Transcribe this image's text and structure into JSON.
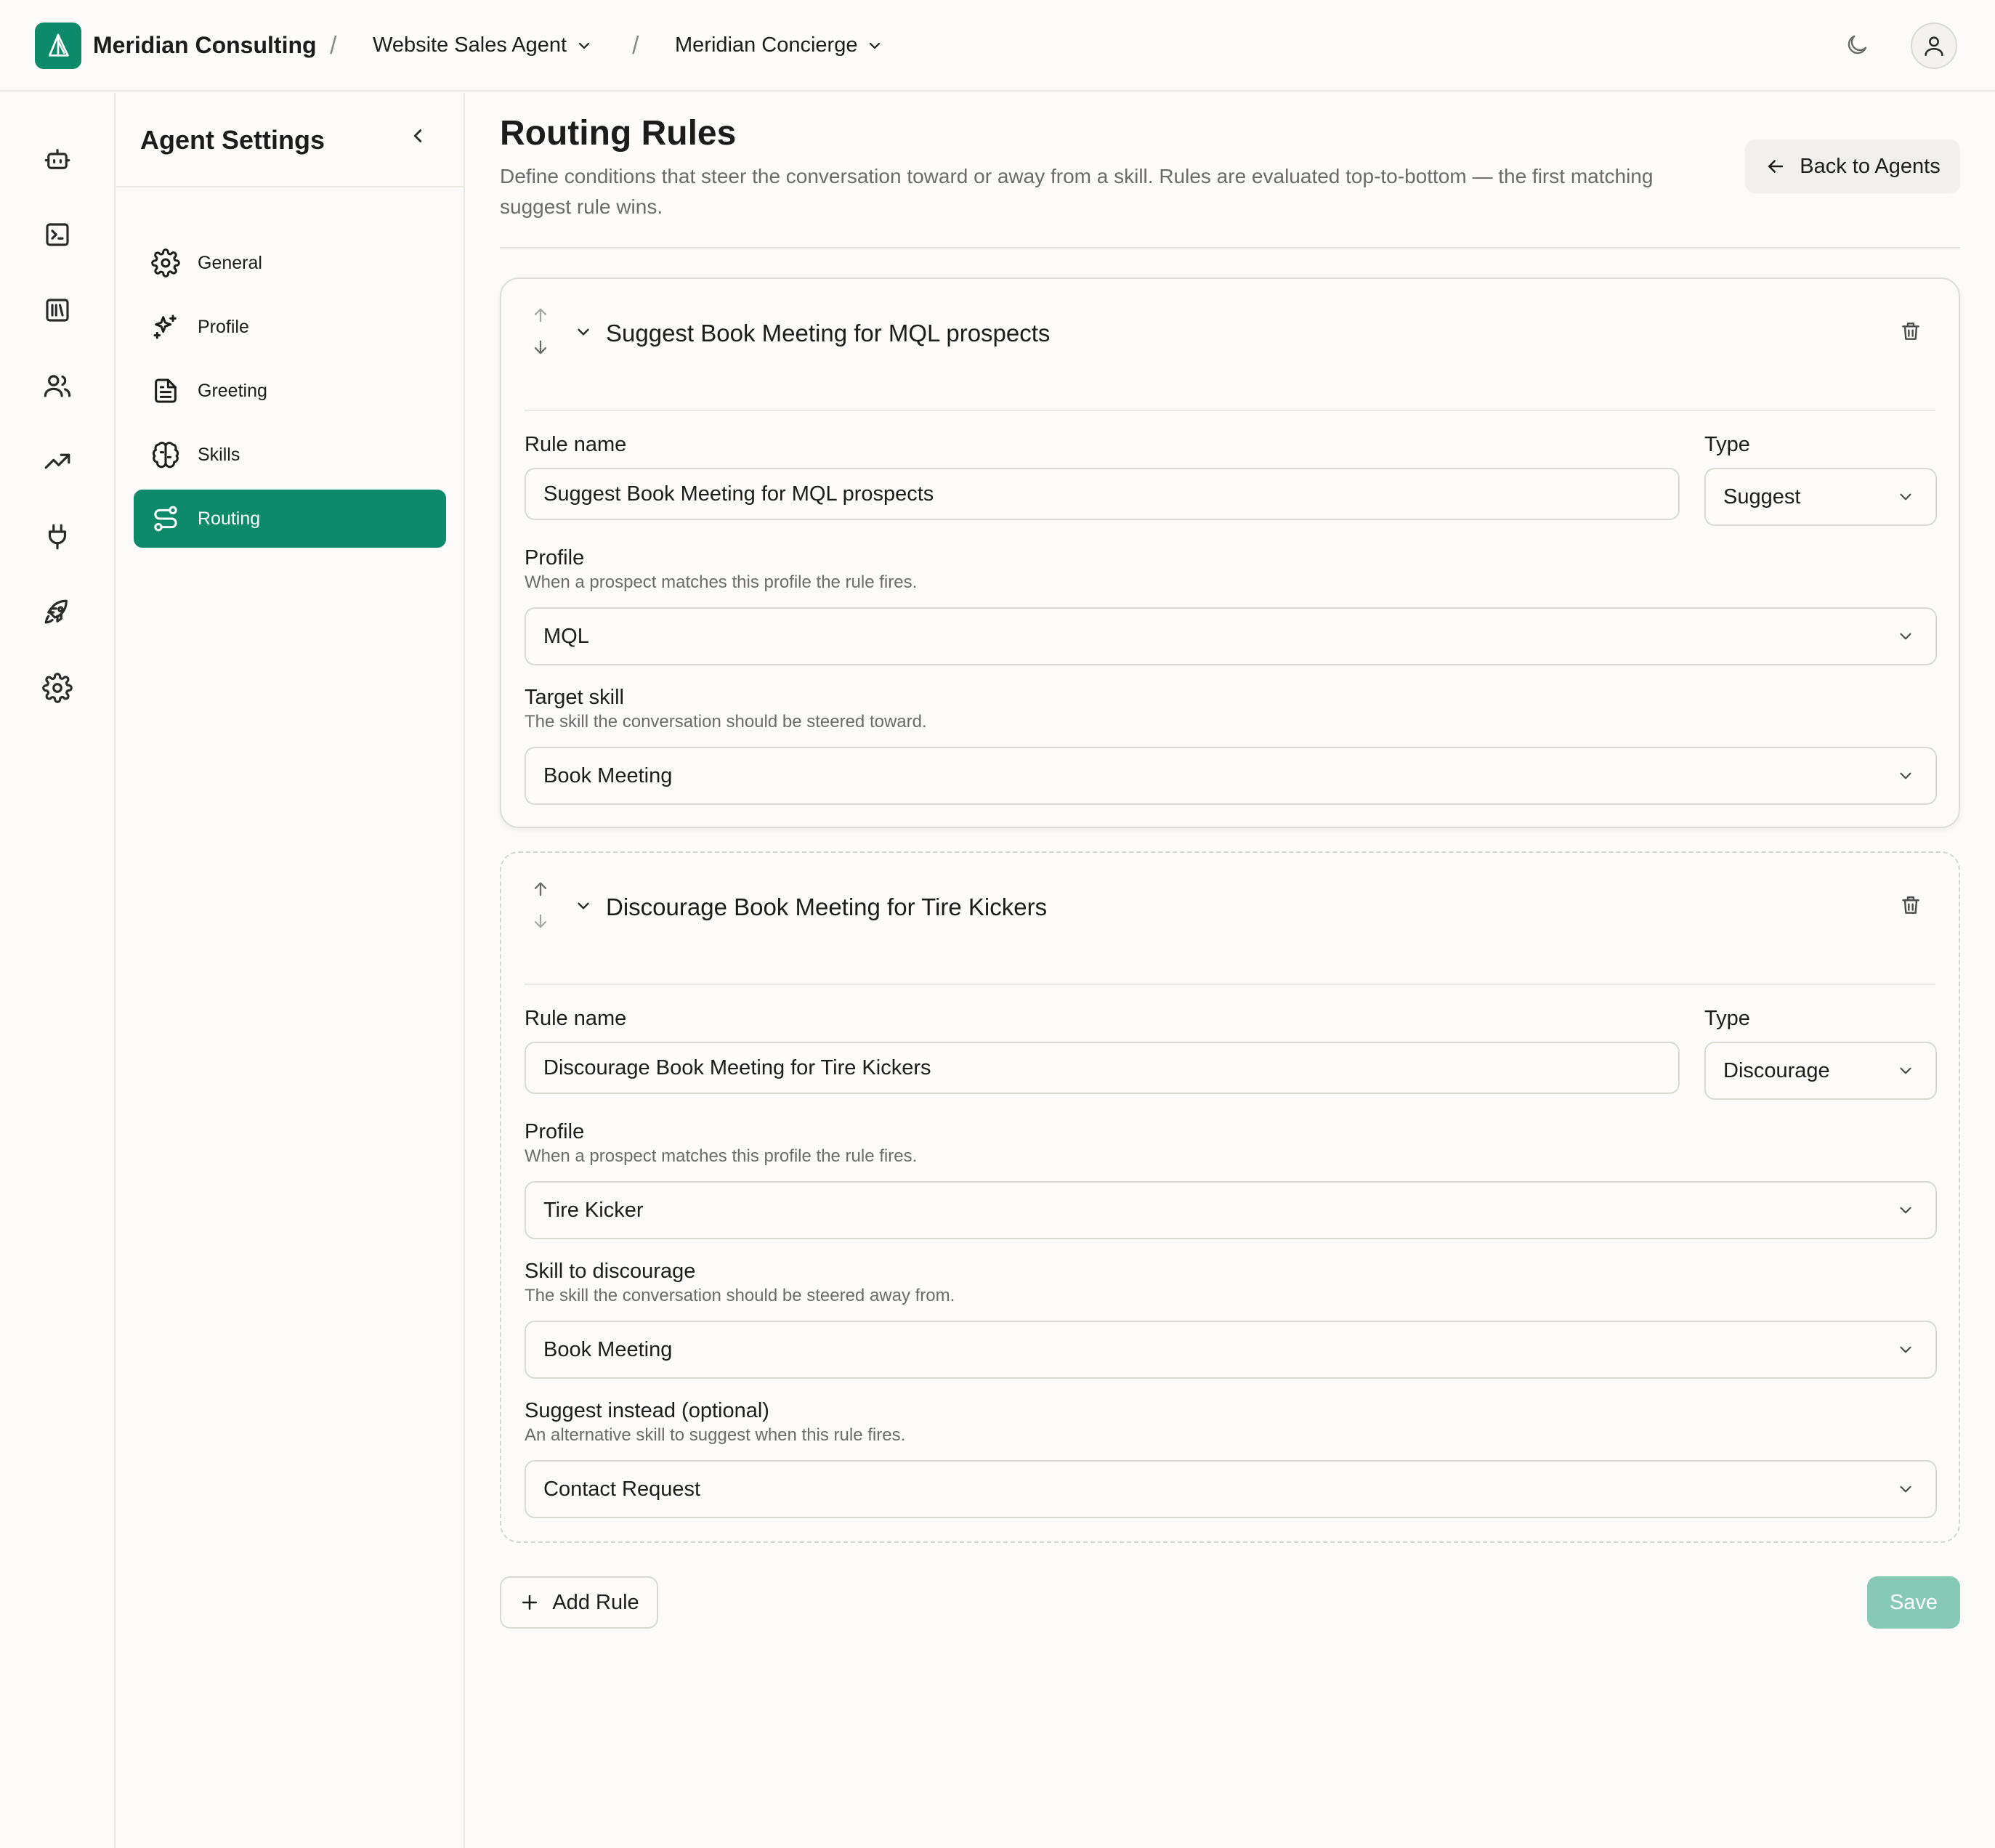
{
  "app": {
    "org_name": "Meridian Consulting",
    "breadcrumb": [
      {
        "label": "Website Sales Agent"
      },
      {
        "label": "Meridian Concierge"
      }
    ],
    "separator": "/"
  },
  "rail": {
    "icons": [
      "bot-icon",
      "terminal-icon",
      "library-icon",
      "users-icon",
      "trending-up-icon",
      "plug-icon",
      "rocket-icon",
      "gear-icon"
    ]
  },
  "sidebar": {
    "title": "Agent Settings",
    "items": [
      {
        "label": "General",
        "icon": "gear-icon"
      },
      {
        "label": "Profile",
        "icon": "sparkles-icon"
      },
      {
        "label": "Greeting",
        "icon": "document-icon"
      },
      {
        "label": "Skills",
        "icon": "brain-icon"
      },
      {
        "label": "Routing",
        "icon": "route-icon",
        "active": true
      }
    ]
  },
  "main": {
    "title": "Routing Rules",
    "description": "Define conditions that steer the conversation toward or away from a skill. Rules are evaluated top-to-bottom — the first matching suggest rule wins.",
    "back_label": "Back to Agents",
    "add_rule_label": "Add Rule",
    "save_label": "Save"
  },
  "rules": [
    {
      "title": "Suggest Book Meeting for MQL prospects",
      "rule_name_label": "Rule name",
      "rule_name_value": "Suggest Book Meeting for MQL prospects",
      "type_label": "Type",
      "type_value": "Suggest",
      "profile_label": "Profile",
      "profile_hint": "When a prospect matches this profile the rule fires.",
      "profile_value": "MQL",
      "skill_label": "Target skill",
      "skill_hint": "The skill the conversation should be steered toward.",
      "skill_value": "Book Meeting"
    },
    {
      "title": "Discourage Book Meeting for Tire Kickers",
      "rule_name_label": "Rule name",
      "rule_name_value": "Discourage Book Meeting for Tire Kickers",
      "type_label": "Type",
      "type_value": "Discourage",
      "profile_label": "Profile",
      "profile_hint": "When a prospect matches this profile the rule fires.",
      "profile_value": "Tire Kicker",
      "skill_label": "Skill to discourage",
      "skill_hint": "The skill the conversation should be steered away from.",
      "skill_value": "Book Meeting",
      "alt_label": "Suggest instead (optional)",
      "alt_hint": "An alternative skill to suggest when this rule fires.",
      "alt_value": "Contact Request"
    }
  ],
  "colors": {
    "accent": "#0d8a6a",
    "save_disabled": "#86c9b5",
    "background": "#fcfbf9"
  }
}
